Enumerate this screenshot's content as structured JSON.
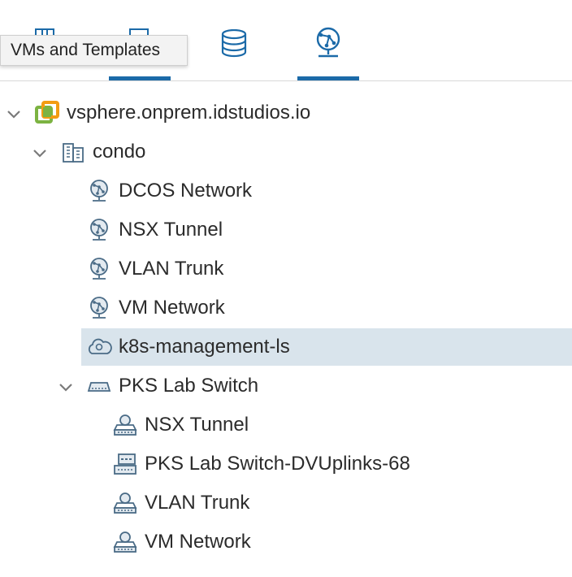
{
  "toolbar": {
    "tabs": [
      {
        "icon": "hosts-and-clusters-icon",
        "active": false
      },
      {
        "icon": "vms-and-templates-icon",
        "active": true
      },
      {
        "icon": "storage-icon",
        "active": false
      },
      {
        "icon": "networking-icon",
        "active": true
      }
    ],
    "tooltip": "VMs and Templates"
  },
  "tree": [
    {
      "label": "vsphere.onprem.idstudios.io",
      "icon": "vcenter-icon",
      "level": 0,
      "expanded": true
    },
    {
      "label": "condo",
      "icon": "datacenter-icon",
      "level": 1,
      "expanded": true
    },
    {
      "label": "DCOS Network",
      "icon": "network-icon",
      "level": 2
    },
    {
      "label": "NSX Tunnel",
      "icon": "network-icon",
      "level": 2
    },
    {
      "label": "VLAN Trunk",
      "icon": "network-icon",
      "level": 2
    },
    {
      "label": "VM Network",
      "icon": "network-icon",
      "level": 2
    },
    {
      "label": "k8s-management-ls",
      "icon": "logical-switch-icon",
      "level": 2,
      "selected": true
    },
    {
      "label": "PKS Lab Switch",
      "icon": "distributed-switch-icon",
      "level": 2,
      "expanded": true
    },
    {
      "label": "NSX Tunnel",
      "icon": "port-group-icon",
      "level": 3
    },
    {
      "label": "PKS Lab Switch-DVUplinks-68",
      "icon": "uplink-port-group-icon",
      "level": 3
    },
    {
      "label": "VLAN Trunk",
      "icon": "port-group-icon",
      "level": 3
    },
    {
      "label": "VM Network",
      "icon": "port-group-icon",
      "level": 3
    }
  ],
  "colors": {
    "accent": "#1b6aa8",
    "selection": "#d9e4ec",
    "vcenter_green": "#7cb342",
    "vcenter_orange": "#f39c12"
  }
}
